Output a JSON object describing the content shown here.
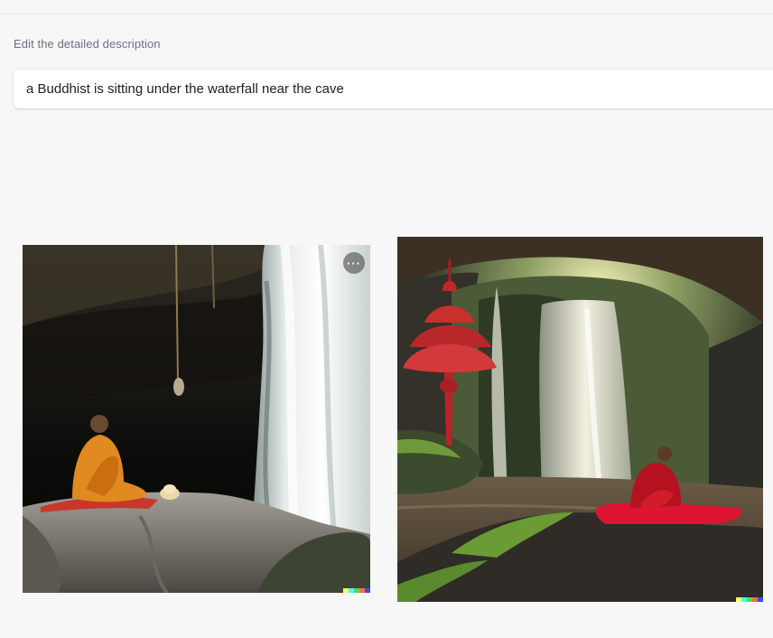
{
  "editor": {
    "section_label": "Edit the detailed description",
    "prompt_value": "a Buddhist is sitting under the waterfall near the cave"
  },
  "results": [
    {
      "alt": "Monk in orange robe meditating beside a waterfall in a dark cave",
      "more_label": "···"
    },
    {
      "alt": "Monk in red robe seated on a mossy rock facing a forest waterfall"
    }
  ],
  "watermark_colors": [
    "#ffff66",
    "#42ffff",
    "#51da4c",
    "#ff6e3c",
    "#3c46ff"
  ]
}
